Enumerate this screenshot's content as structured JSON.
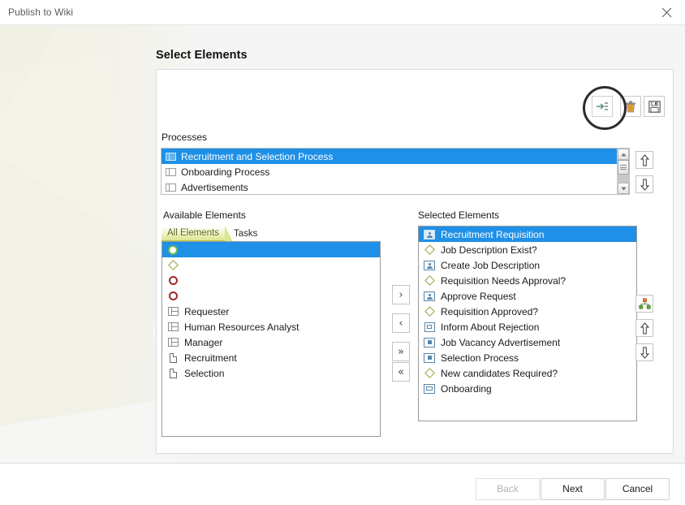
{
  "window": {
    "title": "Publish to Wiki",
    "close_icon": "close-icon"
  },
  "page": {
    "title": "Select Elements"
  },
  "toolbar": {
    "items": [
      {
        "name": "insert-elements-icon",
        "tooltip": "Insert"
      },
      {
        "name": "delete-icon",
        "tooltip": "Delete"
      },
      {
        "name": "save-icon",
        "tooltip": "Save"
      }
    ]
  },
  "processes": {
    "label": "Processes",
    "items": [
      {
        "label": "Recruitment and Selection Process",
        "icon": "pool-icon",
        "selected": true
      },
      {
        "label": "Onboarding Process",
        "icon": "pool-icon",
        "selected": false
      },
      {
        "label": "Advertisements",
        "icon": "pool-icon",
        "selected": false
      }
    ],
    "move_up_icon": "arrow-up-icon",
    "move_down_icon": "arrow-down-icon"
  },
  "available": {
    "label": "Available Elements",
    "tabs": [
      {
        "label": "All Elements",
        "active": true
      },
      {
        "label": "Tasks",
        "active": false
      }
    ],
    "items": [
      {
        "label": "",
        "icon": "start-event-icon",
        "glyph": "g-startevent",
        "selected": true
      },
      {
        "label": "",
        "icon": "gateway-icon",
        "glyph": "g-gateway",
        "selected": false
      },
      {
        "label": "",
        "icon": "end-event-icon",
        "glyph": "g-endevent",
        "selected": false
      },
      {
        "label": "",
        "icon": "end-event-icon",
        "glyph": "g-endevent",
        "selected": false
      },
      {
        "label": "Requester",
        "icon": "lane-icon",
        "glyph": "g-lane",
        "selected": false
      },
      {
        "label": " Human Resources Analyst",
        "icon": "lane-icon",
        "glyph": "g-lane",
        "selected": false
      },
      {
        "label": "Manager",
        "icon": "lane-icon",
        "glyph": "g-lane",
        "selected": false
      },
      {
        "label": "Recruitment",
        "icon": "document-icon",
        "glyph": "g-doc",
        "selected": false
      },
      {
        "label": "Selection",
        "icon": "document-icon",
        "glyph": "g-doc",
        "selected": false
      }
    ]
  },
  "transfer": {
    "buttons": [
      {
        "name": "move-right-button",
        "glyph": "›"
      },
      {
        "name": "move-left-button",
        "glyph": "‹"
      },
      {
        "name": "move-all-right-button",
        "glyph": "»"
      },
      {
        "name": "move-all-left-button",
        "glyph": "«"
      }
    ]
  },
  "selected": {
    "label": "Selected Elements",
    "items": [
      {
        "label": "Recruitment Requisition",
        "icon": "user-task-icon",
        "glyph": "g-usertask",
        "selected": true
      },
      {
        "label": "Job Description  Exist?",
        "icon": "gateway-icon",
        "glyph": "g-gateway",
        "selected": false
      },
      {
        "label": "Create Job Description",
        "icon": "user-task-icon",
        "glyph": "g-usertask",
        "selected": false
      },
      {
        "label": "Requisition Needs Approval?",
        "icon": "gateway-icon",
        "glyph": "g-gateway",
        "selected": false
      },
      {
        "label": "Approve Request",
        "icon": "user-task-icon",
        "glyph": "g-usertask",
        "selected": false
      },
      {
        "label": "Requisition Approved?",
        "icon": "gateway-icon",
        "glyph": "g-gateway",
        "selected": false
      },
      {
        "label": "Inform About Rejection",
        "icon": "send-task-icon",
        "glyph": "g-sendtask",
        "selected": false
      },
      {
        "label": "Job Vacancy Advertisement",
        "icon": "sub-process-icon",
        "glyph": "g-subprocess",
        "selected": false
      },
      {
        "label": "Selection Process",
        "icon": "sub-process-icon",
        "glyph": "g-subprocess",
        "selected": false
      },
      {
        "label": " New candidates Required?",
        "icon": "gateway-icon",
        "glyph": "g-gateway",
        "selected": false
      },
      {
        "label": "Onboarding",
        "icon": "call-activity-icon",
        "glyph": "g-callactivity",
        "selected": false
      }
    ],
    "tree_icon": "hierarchy-icon",
    "move_up_icon": "arrow-up-icon",
    "move_down_icon": "arrow-down-icon"
  },
  "footer": {
    "back_label": "Back",
    "back_disabled": true,
    "next_label": "Next",
    "cancel_label": "Cancel"
  },
  "colors": {
    "selection_blue": "#1e90e8",
    "tab_active_green": "#dbe58f",
    "gateway_olive": "#9aa03c",
    "end_event_red": "#9e2b2b",
    "start_event_green": "#4f9d3a",
    "backdrop_cream": "#eeeee0"
  }
}
